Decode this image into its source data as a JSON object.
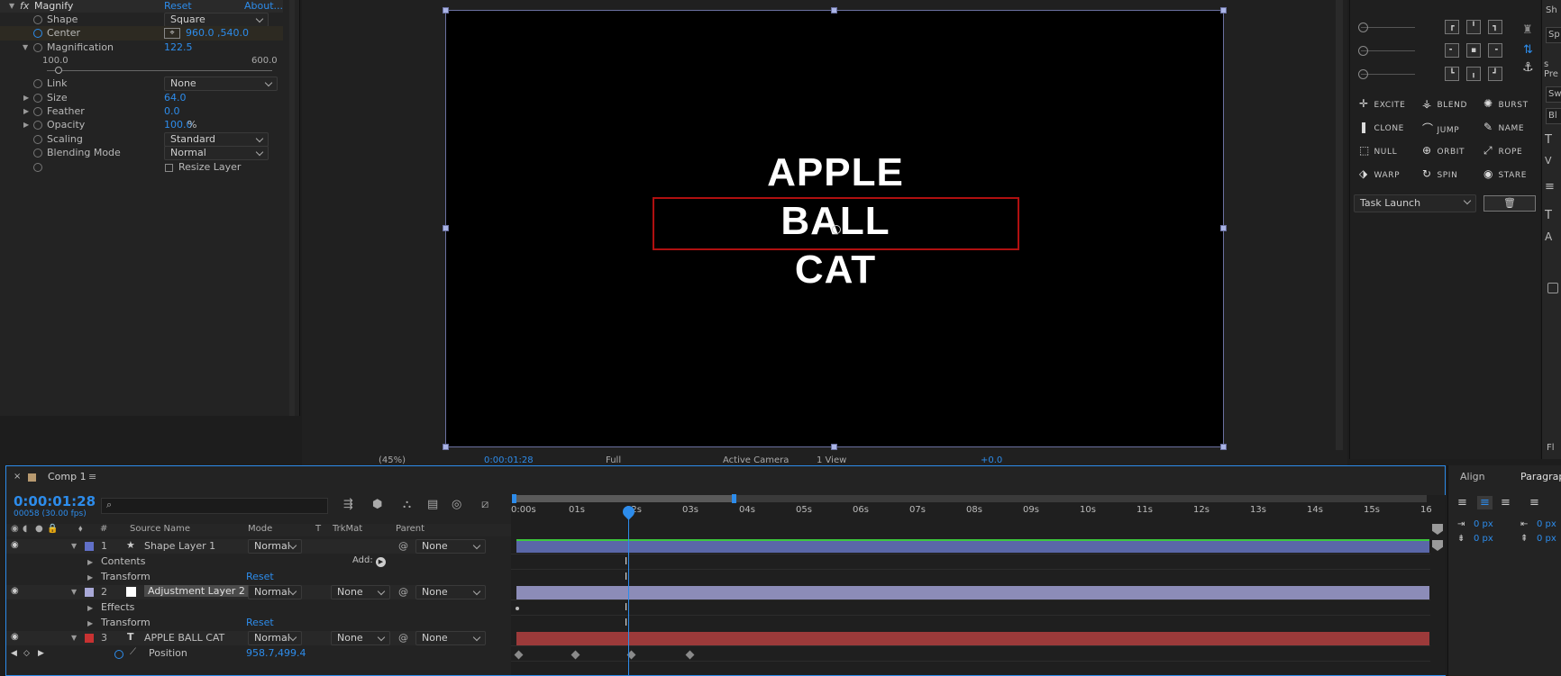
{
  "effect": {
    "name": "Magnify",
    "fx": "fx",
    "reset": "Reset",
    "about": "About...",
    "rows": {
      "shape_label": "Shape",
      "shape_value": "Square",
      "center_label": "Center",
      "center_value": "960.0 ,540.0",
      "mag_label": "Magnification",
      "mag_value": "122.5",
      "slider_min": "100.0",
      "slider_max": "600.0",
      "link_label": "Link",
      "link_value": "None",
      "size_label": "Size",
      "size_value": "64.0",
      "feather_label": "Feather",
      "feather_value": "0.0",
      "opacity_label": "Opacity",
      "opacity_value": "100.0",
      "opacity_unit": "%",
      "scaling_label": "Scaling",
      "scaling_value": "Standard",
      "blend_label": "Blending Mode",
      "blend_value": "Normal",
      "resize_label": "Resize Layer"
    }
  },
  "canvas": {
    "lines": [
      "APPLE",
      "BALL",
      "CAT"
    ]
  },
  "viewer_bar": {
    "zoom": "(45%)",
    "timecode": "0:00:01:28",
    "resolution": "Full",
    "camera": "Active Camera",
    "views": "1 View",
    "exposure": "+0.0"
  },
  "duik": {
    "items": [
      {
        "icon": "✛",
        "label": "EXCITE"
      },
      {
        "icon": "⚶",
        "label": "BLEND"
      },
      {
        "icon": "✺",
        "label": "BURST"
      },
      {
        "icon": "❚",
        "label": "CLONE"
      },
      {
        "icon": "⌒",
        "label": "JUMP"
      },
      {
        "icon": "✎",
        "label": "NAME"
      },
      {
        "icon": "⬚",
        "label": "NULL"
      },
      {
        "icon": "⊕",
        "label": "ORBIT"
      },
      {
        "icon": "⤢",
        "label": "ROPE"
      },
      {
        "icon": "⬗",
        "label": "WARP"
      },
      {
        "icon": "↻",
        "label": "SPIN"
      },
      {
        "icon": "◉",
        "label": "STARE"
      }
    ],
    "task_launch": "Task Launch",
    "side_letters": [
      "Sh",
      "Sp",
      "s Pre",
      "Sw",
      "Bl",
      "Fl"
    ]
  },
  "timeline": {
    "tab": "Comp 1",
    "timecode": "0:00:01:28",
    "subcode": "00058 (30.00 fps)",
    "headers": {
      "num": "#",
      "source": "Source Name",
      "mode": "Mode",
      "t": "T",
      "trkmat": "TrkMat",
      "parent": "Parent"
    },
    "ticks": [
      "0:00s",
      "01s",
      "02s",
      "03s",
      "04s",
      "05s",
      "06s",
      "07s",
      "08s",
      "09s",
      "10s",
      "11s",
      "12s",
      "13s",
      "14s",
      "15s",
      "16"
    ],
    "layers": [
      {
        "num": "1",
        "name": "Shape Layer 1",
        "mode": "Normal",
        "trkmat": "",
        "parent": "None",
        "color": "#6170c8"
      },
      {
        "num": "2",
        "name": "Adjustment Layer 2",
        "mode": "Normal",
        "trkmat": "None",
        "parent": "None",
        "color": "#a9a9d8"
      },
      {
        "num": "3",
        "name": "APPLE BALL CAT",
        "mode": "Normal",
        "trkmat": "None",
        "parent": "None",
        "color": "#c83232"
      }
    ],
    "sub": {
      "contents": "Contents",
      "add": "Add:",
      "transform": "Transform",
      "reset": "Reset",
      "effects": "Effects",
      "position": "Position",
      "position_value": "958.7,499.4"
    }
  },
  "align": {
    "tab1": "Align",
    "tab2": "Paragraph",
    "px1": "0 px",
    "px2": "0 px",
    "px3": "0 px",
    "px4": "0 px"
  }
}
